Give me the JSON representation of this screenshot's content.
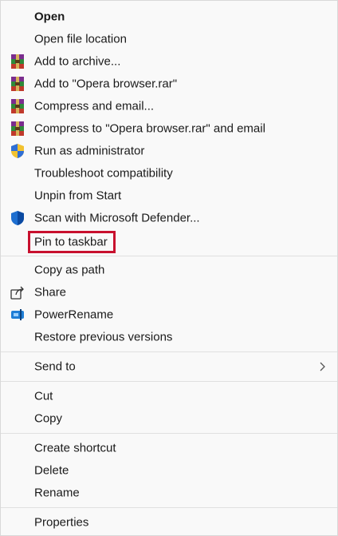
{
  "menu": {
    "items": [
      {
        "label": "Open",
        "bold": true,
        "icon": ""
      },
      {
        "label": "Open file location",
        "icon": ""
      },
      {
        "label": "Add to archive...",
        "icon": "winrar-icon"
      },
      {
        "label": "Add to \"Opera browser.rar\"",
        "icon": "winrar-icon"
      },
      {
        "label": "Compress and email...",
        "icon": "winrar-icon"
      },
      {
        "label": "Compress to \"Opera browser.rar\" and email",
        "icon": "winrar-icon"
      },
      {
        "label": "Run as administrator",
        "icon": "uac-shield-icon"
      },
      {
        "label": "Troubleshoot compatibility",
        "icon": ""
      },
      {
        "label": "Unpin from Start",
        "icon": ""
      },
      {
        "label": "Scan with Microsoft Defender...",
        "icon": "defender-shield-icon"
      },
      {
        "label": "Pin to taskbar",
        "icon": "",
        "highlighted": true
      },
      {
        "label": "Copy as path",
        "icon": ""
      },
      {
        "label": "Share",
        "icon": "share-icon"
      },
      {
        "label": "PowerRename",
        "icon": "powerrename-icon"
      },
      {
        "label": "Restore previous versions",
        "icon": ""
      },
      {
        "label": "Send to",
        "icon": "",
        "submenu": true
      },
      {
        "label": "Cut",
        "icon": ""
      },
      {
        "label": "Copy",
        "icon": ""
      },
      {
        "label": "Create shortcut",
        "icon": ""
      },
      {
        "label": "Delete",
        "icon": ""
      },
      {
        "label": "Rename",
        "icon": ""
      },
      {
        "label": "Properties",
        "icon": ""
      }
    ],
    "highlight_color": "#c8102e"
  }
}
